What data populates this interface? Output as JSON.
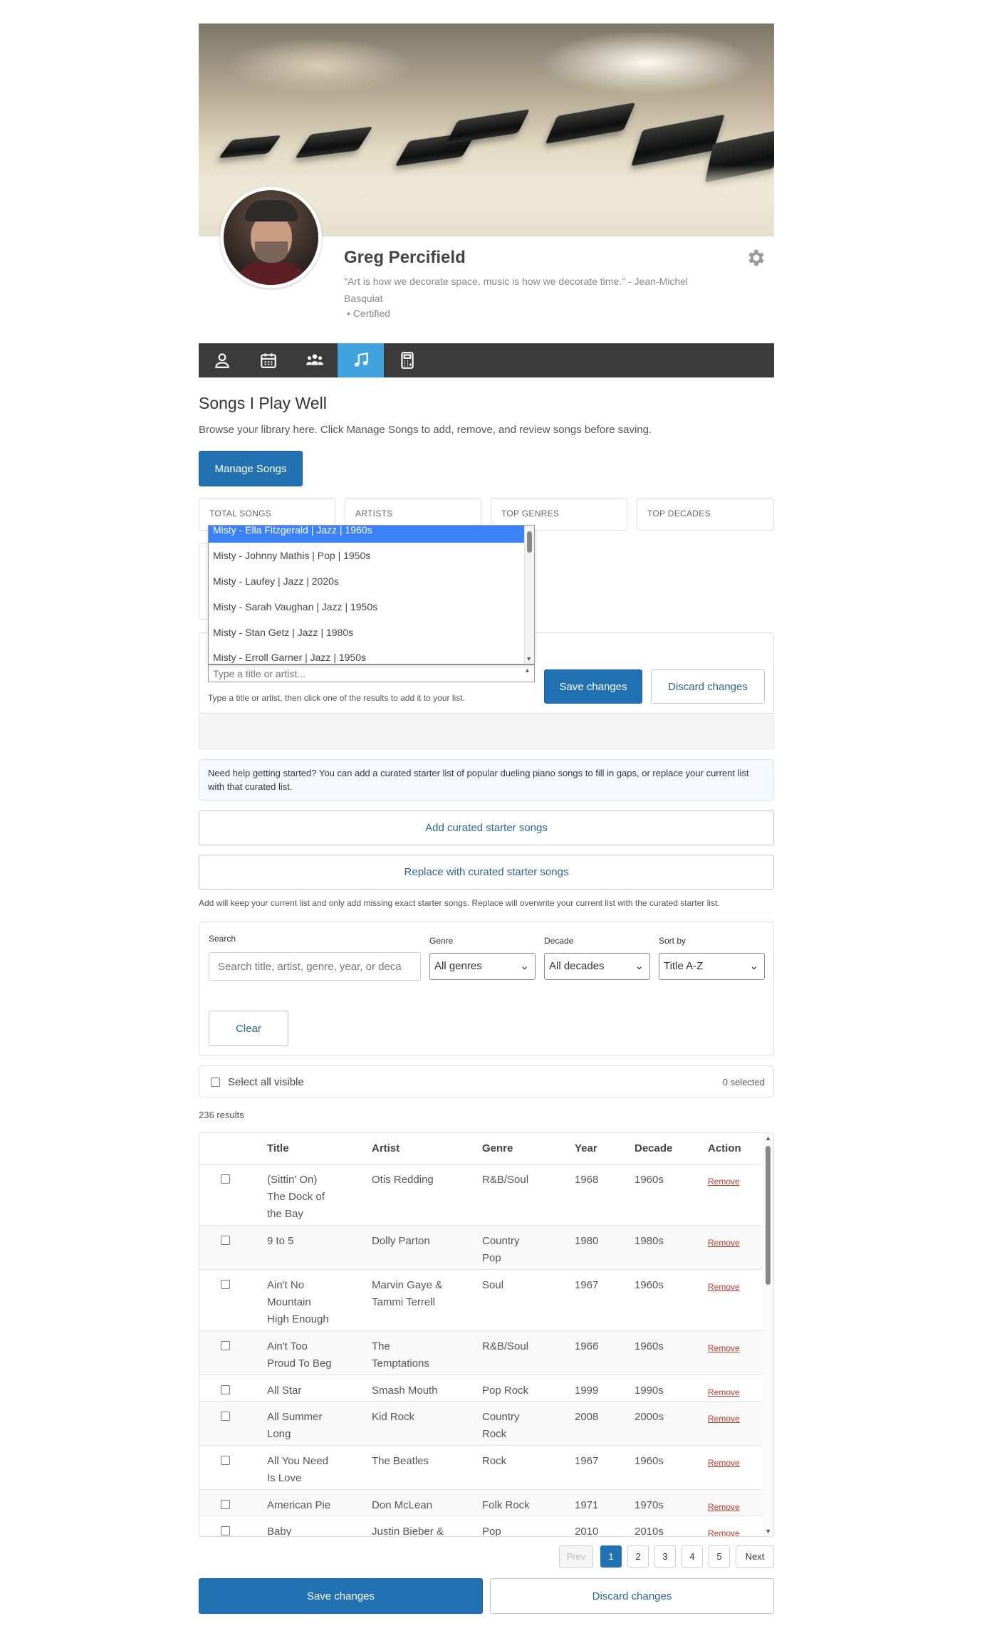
{
  "profile": {
    "name": "Greg Percifield",
    "quote": "\"Art is how we decorate space, music is how we decorate time.\" - Jean-Michel Basquiat",
    "certified": "•  Certified"
  },
  "tabs": [
    {
      "icon": "user-icon"
    },
    {
      "icon": "calendar-icon"
    },
    {
      "icon": "group-icon"
    },
    {
      "icon": "music-note-icon",
      "active": true
    },
    {
      "icon": "calculator-icon"
    }
  ],
  "section": {
    "title": "Songs I Play Well",
    "subtitle": "Browse your library here. Click Manage Songs to add, remove, and review songs before saving.",
    "manage_label": "Manage Songs"
  },
  "stats": {
    "total": "TOTAL SONGS",
    "artists": "ARTISTS",
    "genres": "TOP GENRES",
    "decades": "TOP DECADES"
  },
  "autocomplete": {
    "options": [
      "Misty - Ella Fitzgerald | Jazz | 1960s",
      "Misty - Johnny Mathis | Pop | 1950s",
      "Misty - Laufey | Jazz | 2020s",
      "Misty - Sarah Vaughan | Jazz | 1950s",
      "Misty - Stan Getz | Jazz | 1980s",
      "Misty - Erroll Garner | Jazz | 1950s"
    ],
    "placeholder": "Type a title or artist...",
    "hint": "Type a title or artist, then click one of the results to add it to your list."
  },
  "editor": {
    "save_label": "Save changes",
    "discard_label": "Discard changes"
  },
  "help": {
    "text": "Need help getting started? You can add a curated starter list of popular dueling piano songs to fill in gaps, or replace your current list with that curated list.",
    "add_label": "Add curated starter songs",
    "replace_label": "Replace with curated starter songs",
    "note": "Add will keep your current list and only add missing exact starter songs. Replace will overwrite your current list with the curated starter list."
  },
  "filters": {
    "search_label": "Search",
    "search_placeholder": "Search title, artist, genre, year, or deca",
    "genre_label": "Genre",
    "genre_value": "All genres",
    "decade_label": "Decade",
    "decade_value": "All decades",
    "sort_label": "Sort by",
    "sort_value": "Title A-Z",
    "clear_label": "Clear"
  },
  "selection": {
    "select_all_label": "Select all visible",
    "count": "0 selected",
    "results": "236 results"
  },
  "table": {
    "headers": [
      "Title",
      "Artist",
      "Genre",
      "Year",
      "Decade",
      "Action"
    ],
    "rows": [
      {
        "title": [
          "(Sittin' On)",
          "The Dock of",
          "the Bay"
        ],
        "artist": [
          "Otis Redding"
        ],
        "genre": [
          "R&B/Soul"
        ],
        "year": "1968",
        "decade": "1960s",
        "action": "Remove"
      },
      {
        "title": [
          "9 to 5"
        ],
        "artist": [
          "Dolly Parton"
        ],
        "genre": [
          "Country",
          "Pop"
        ],
        "year": "1980",
        "decade": "1980s",
        "action": "Remove"
      },
      {
        "title": [
          "Ain't No",
          "Mountain",
          "High Enough"
        ],
        "artist": [
          "Marvin Gaye &",
          "Tammi Terrell"
        ],
        "genre": [
          "Soul"
        ],
        "year": "1967",
        "decade": "1960s",
        "action": "Remove"
      },
      {
        "title": [
          "Ain't Too",
          "Proud To Beg"
        ],
        "artist": [
          "The",
          "Temptations"
        ],
        "genre": [
          "R&B/Soul"
        ],
        "year": "1966",
        "decade": "1960s",
        "action": "Remove"
      },
      {
        "title": [
          "All Star"
        ],
        "artist": [
          "Smash Mouth"
        ],
        "genre": [
          "Pop Rock"
        ],
        "year": "1999",
        "decade": "1990s",
        "action": "Remove"
      },
      {
        "title": [
          "All Summer",
          "Long"
        ],
        "artist": [
          "Kid Rock"
        ],
        "genre": [
          "Country",
          "Rock"
        ],
        "year": "2008",
        "decade": "2000s",
        "action": "Remove"
      },
      {
        "title": [
          "All You Need",
          "Is Love"
        ],
        "artist": [
          "The Beatles"
        ],
        "genre": [
          "Rock"
        ],
        "year": "1967",
        "decade": "1960s",
        "action": "Remove"
      },
      {
        "title": [
          "American Pie"
        ],
        "artist": [
          "Don McLean"
        ],
        "genre": [
          "Folk Rock"
        ],
        "year": "1971",
        "decade": "1970s",
        "action": "Remove"
      },
      {
        "title": [
          "Baby"
        ],
        "artist": [
          "Justin Bieber &"
        ],
        "genre": [
          "Pop"
        ],
        "year": "2010",
        "decade": "2010s",
        "action": "Remove"
      }
    ]
  },
  "pagination": {
    "prev": "Prev",
    "pages": [
      "1",
      "2",
      "3",
      "4",
      "5"
    ],
    "next": "Next",
    "current": "1"
  },
  "footer": {
    "save_label": "Save changes",
    "discard_label": "Discard changes"
  }
}
